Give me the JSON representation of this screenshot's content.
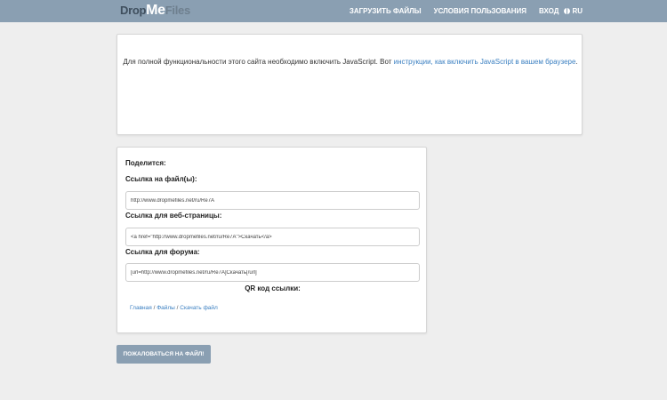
{
  "colors": {
    "navbar": "#8a9fb2",
    "background": "#eeeeee",
    "link": "#3a7fc1",
    "panel": "#ffffff"
  },
  "header": {
    "logo": {
      "part1": "Drop",
      "part2": "Me",
      "part3": "Files"
    },
    "nav": {
      "upload": "ЗАГРУЗИТЬ ФАЙЛЫ",
      "terms": "УСЛОВИЯ ПОЛЬЗОВАНИЯ",
      "login": "ВХОД",
      "language": "RU"
    }
  },
  "notice": {
    "text": "Для полной функциональности этого сайта необходимо включить JavaScript. Вот ",
    "link": "инструкции, как включить JavaScript в вашем браузере",
    "end": "."
  },
  "share": {
    "title": "Поделится:",
    "file_link_label": "Ссылка на файл(ы):",
    "file_link_value": "http://www.dropmefiles.net/ru/Re7A",
    "web_label": "Ссылка для веб-страницы:",
    "web_value": "<a href=\"http://www.dropmefiles.net/ru/Re7A\">Скачать</a>",
    "forum_label": "Ссылка для форума:",
    "forum_value": "[url=http://www.dropmefiles.net/ru/Re7A]Скачать[/url]",
    "qr_label": "QR код ссылки:",
    "breadcrumbs": {
      "home": "Главная",
      "files": "Файлы",
      "download": "Скачать файл",
      "sep": "/"
    }
  },
  "report_button": "ПОЖАЛОВАТЬСЯ НА ФАЙЛ!"
}
